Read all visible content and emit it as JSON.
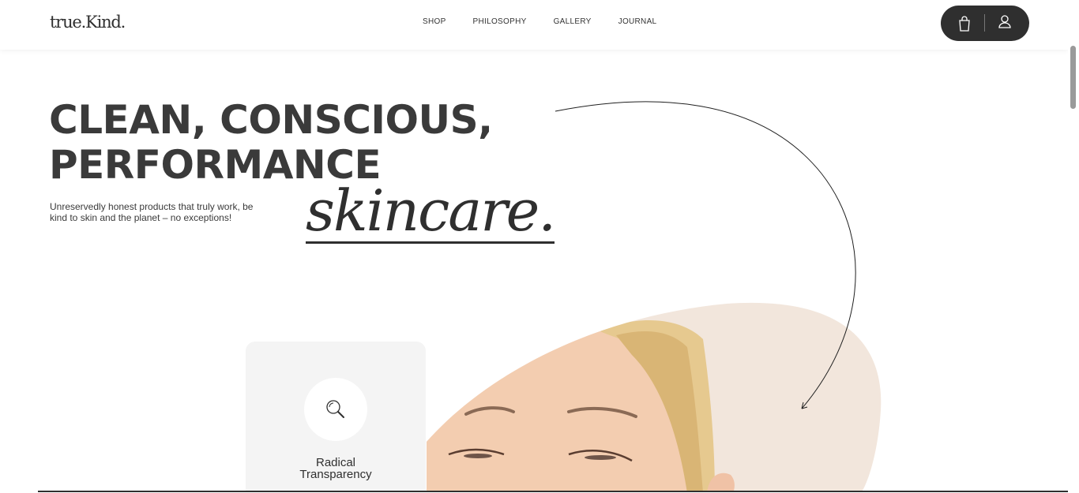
{
  "header": {
    "logo": "true.Kind.",
    "nav": [
      "SHOP",
      "PHILOSOPHY",
      "GALLERY",
      "JOURNAL"
    ],
    "cart_icon": "shopping-bag-icon",
    "account_icon": "user-icon"
  },
  "hero": {
    "headline_line1": "CLEAN, CONSCIOUS,",
    "headline_line2": "PERFORMANCE",
    "subtitle": "Unreservedly honest products that truly work, be kind to skin and the planet – no exceptions!",
    "script_word": "skincare."
  },
  "feature": {
    "icon": "magnifier-icon",
    "title_line1": "Radical",
    "title_line2": "Transparency"
  },
  "colors": {
    "ink": "#2f2f2f",
    "blob": "#f2e6dc",
    "card": "#f4f4f4"
  }
}
